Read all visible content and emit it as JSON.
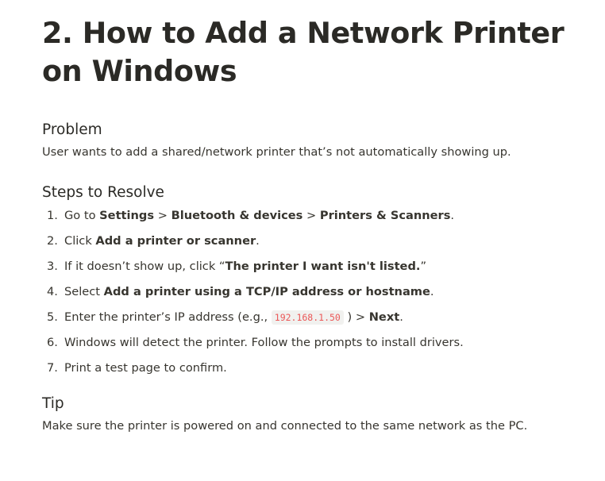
{
  "title": "2. How to Add a Network Printer on Windows",
  "problem": {
    "heading": "Problem",
    "text": "User wants to add a shared/network printer that’s not automatically showing up."
  },
  "steps": {
    "heading": "Steps to Resolve",
    "items": [
      {
        "number": "1.",
        "t1": "Go to ",
        "b1": "Settings",
        "t2": " > ",
        "b2": "Bluetooth & devices",
        "t3": " > ",
        "b3": "Printers & Scanners",
        "t4": "."
      },
      {
        "number": "2.",
        "t1": "Click ",
        "b1": "Add a printer or scanner",
        "t2": "."
      },
      {
        "number": "3.",
        "t1": "If it doesn’t show up, click “",
        "b1": "The printer I want isn't listed.",
        "t2": "”"
      },
      {
        "number": "4.",
        "t1": "Select ",
        "b1": "Add a printer using a TCP/IP address or hostname",
        "t2": "."
      },
      {
        "number": "5.",
        "t1": "Enter the printer’s IP address (e.g., ",
        "code": "192.168.1.50",
        "t2": " ) > ",
        "b1": "Next",
        "t3": "."
      },
      {
        "number": "6.",
        "t1": "Windows will detect the printer. Follow the prompts to install drivers."
      },
      {
        "number": "7.",
        "t1": "Print a test page to confirm."
      }
    ]
  },
  "tip": {
    "heading": "Tip",
    "text": "Make sure the printer is powered on and connected to the same network as the PC."
  }
}
